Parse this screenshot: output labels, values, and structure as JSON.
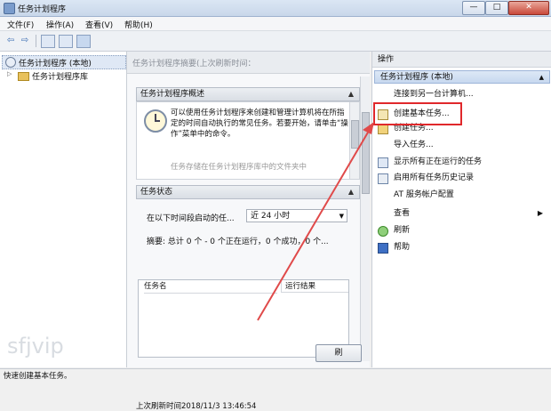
{
  "window": {
    "title": "任务计划程序",
    "minimize": "—",
    "maximize": "□",
    "close": "✕"
  },
  "menubar": {
    "items": [
      "文件(F)",
      "操作(A)",
      "查看(V)",
      "帮助(H)"
    ]
  },
  "toolbar": {
    "back": "⇦",
    "forward": "⇨"
  },
  "tree": {
    "root": "任务计划程序 (本地)",
    "child": "任务计划程序库",
    "expander": "▷"
  },
  "center": {
    "header": "任务计划程序摘要(上次刷新时间：",
    "overview": {
      "title": "任务计划程序概述",
      "text": "可以使用任务计划程序来创建和管理计算机将在所指定的时间自动执行的常见任务。若要开始，请单击“操作”菜单中的命令。",
      "more": "任务存储在任务计划程序库中的文件夹中"
    },
    "status": {
      "title": "任务状态",
      "filter_label": "在以下时间段启动的任...",
      "filter_value": "近 24 小时",
      "summary": "摘要: 总计 0 个 - 0 个正在运行，0 个成功，0 个...",
      "table_headers": [
        "任务名",
        "运行结果"
      ]
    },
    "footer_text": "上次刷新时间2018/11/3 13:46:54",
    "refresh_button": "刷"
  },
  "actions": {
    "header": "操作",
    "subheader": "任务计划程序 (本地)",
    "items": [
      {
        "label": "连接到另一台计算机...",
        "icon": "blank-icon"
      },
      {
        "label": "创建基本任务...",
        "icon": "wizard-icon"
      },
      {
        "label": "创建任务...",
        "icon": "new-task-icon"
      },
      {
        "label": "导入任务...",
        "icon": "blank-icon"
      },
      {
        "label": "显示所有正在运行的任务",
        "icon": "running-tasks-icon"
      },
      {
        "label": "启用所有任务历史记录",
        "icon": "history-icon"
      },
      {
        "label": "AT 服务帐户配置",
        "icon": "blank-icon"
      },
      {
        "label": "查看",
        "icon": "blank-icon",
        "submenu": "▶"
      },
      {
        "label": "刷新",
        "icon": "refresh-icon"
      },
      {
        "label": "帮助",
        "icon": "help-icon"
      }
    ],
    "highlight_color": "#e0282b"
  },
  "statusbar": {
    "text": "快速创建基本任务。"
  },
  "watermark": "sfjvip",
  "colors": {
    "arrow": "#e04a4a",
    "selection": "#c7d8ef"
  }
}
